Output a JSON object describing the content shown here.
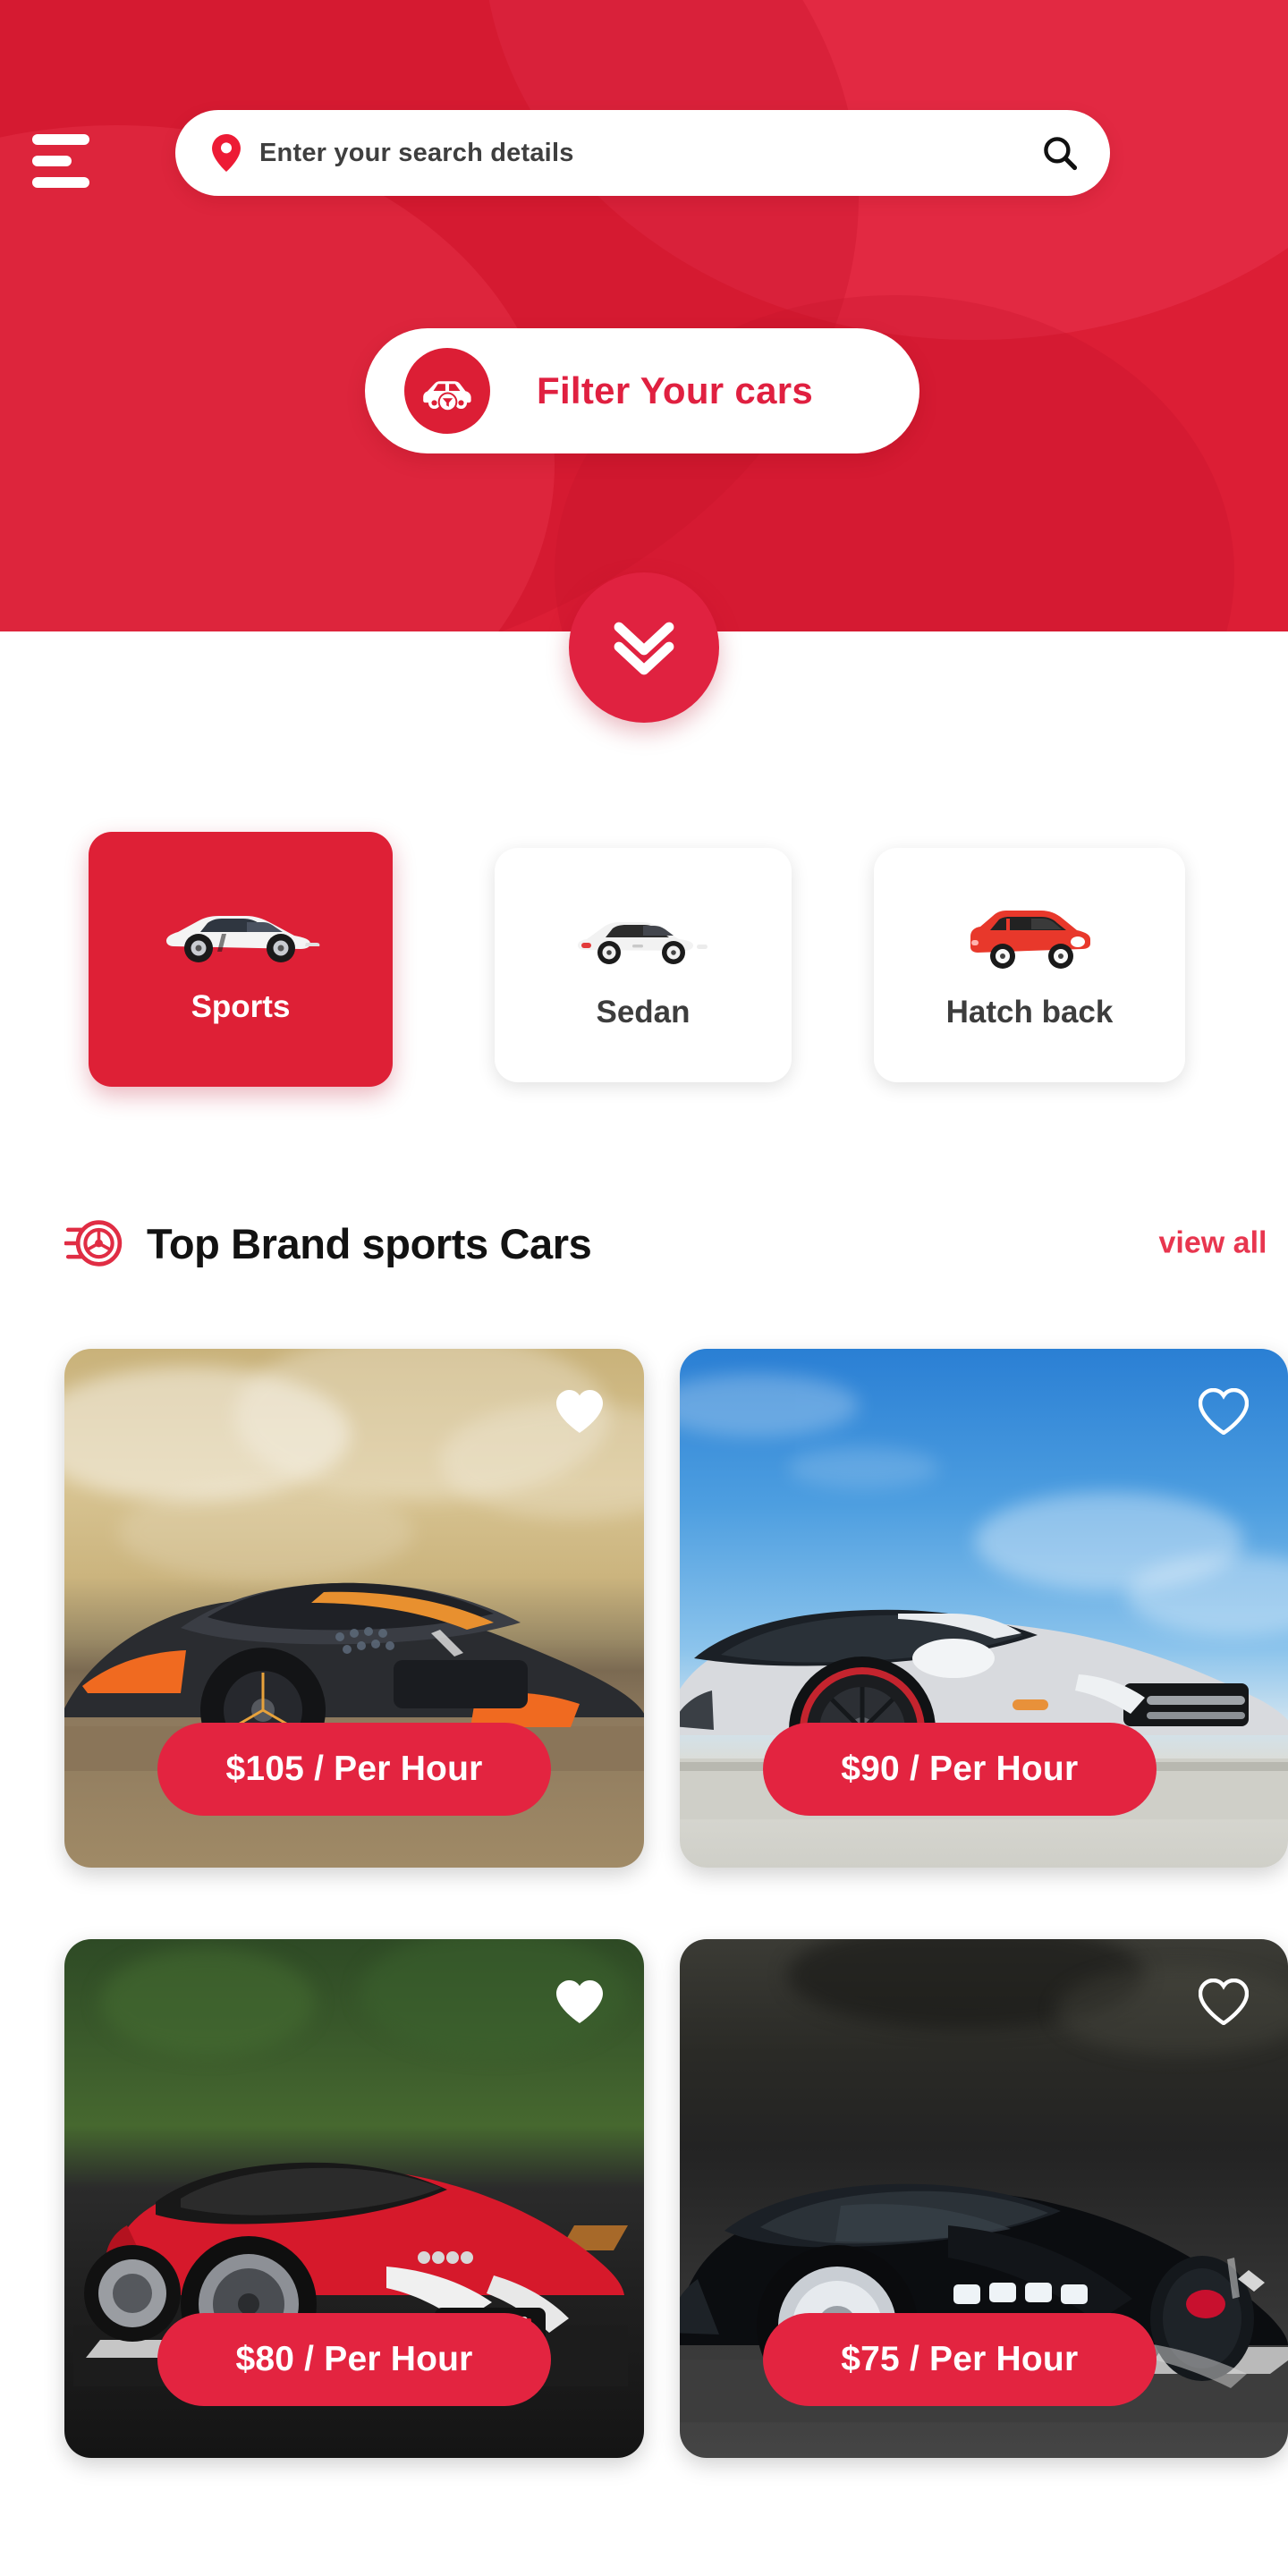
{
  "app": {
    "accent_color": "#DC1E35",
    "price_pill_color": "#E32440",
    "background_color": "#FFFFFF"
  },
  "header": {
    "menu_icon": "hamburger-menu-icon",
    "search": {
      "placeholder": "Enter your search details",
      "value": "",
      "location_icon": "location-pin-icon",
      "submit_icon": "search-icon"
    },
    "filter_button": {
      "label": "Filter Your cars",
      "icon": "car-filter-icon"
    },
    "scroll_down": {
      "icon": "double-chevron-down-icon"
    }
  },
  "categories": [
    {
      "label": "Sports",
      "icon": "sports-car-icon",
      "active": true
    },
    {
      "label": "Sedan",
      "icon": "sedan-car-icon",
      "active": false
    },
    {
      "label": "Hatch back",
      "icon": "hatchback-car-icon",
      "active": false
    }
  ],
  "section": {
    "icon": "tire-wheel-icon",
    "title": "Top Brand sports Cars",
    "view_all_label": "view all"
  },
  "cars": [
    {
      "price_label": "$105 / Per Hour",
      "price": 105,
      "rate_unit": "Per Hour",
      "favorite": true,
      "favorite_icon": "heart-filled-icon",
      "photo": "dark-orange-concept-supercar-cloudy-dusk"
    },
    {
      "price_label": "$90 / Per Hour",
      "price": 90,
      "rate_unit": "Per Hour",
      "favorite": false,
      "favorite_icon": "heart-outline-icon",
      "photo": "silver-audi-r8-blue-sky-gravel"
    },
    {
      "price_label": "$80 / Per Hour",
      "price": 80,
      "rate_unit": "Per Hour",
      "favorite": true,
      "favorite_icon": "heart-filled-icon",
      "photo": "red-audi-tt-rs-forest-road"
    },
    {
      "price_label": "$75 / Per Hour",
      "price": 75,
      "rate_unit": "Per Hour",
      "favorite": false,
      "favorite_icon": "heart-outline-icon",
      "photo": "black-bugatti-chiron-motion-blur-road"
    }
  ]
}
